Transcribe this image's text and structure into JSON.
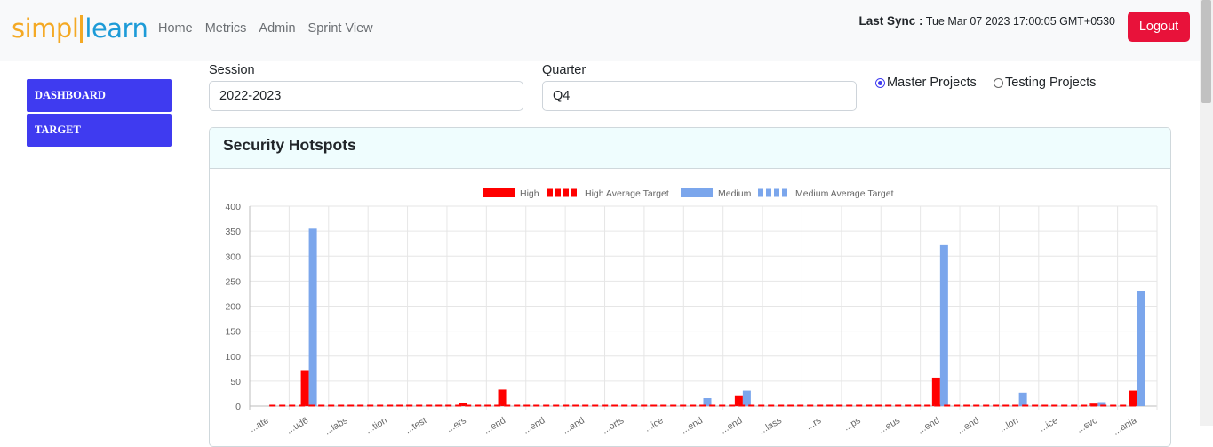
{
  "navbar": {
    "logo": {
      "part1": "simpl",
      "part2": "learn"
    },
    "links": [
      "Home",
      "Metrics",
      "Admin",
      "Sprint View"
    ],
    "last_sync_label": "Last Sync :",
    "last_sync_value": "Tue Mar 07 2023 17:00:05 GMT+0530",
    "logout_label": "Logout"
  },
  "sidebar": {
    "items": [
      "DASHBOARD",
      "TARGET"
    ]
  },
  "filters": {
    "session_label": "Session",
    "session_value": "2022-2023",
    "quarter_label": "Quarter",
    "quarter_value": "Q4",
    "radio_master": "Master Projects",
    "radio_testing": "Testing Projects",
    "selected": "master"
  },
  "card": {
    "title": "Security Hotspots"
  },
  "colors": {
    "high": "#ff0000",
    "medium": "#7ba6ec",
    "accent": "#3f3bf0",
    "logout": "#e8123a"
  },
  "chart_data": {
    "type": "bar",
    "ylim": [
      0,
      400
    ],
    "yticks": [
      0,
      50,
      100,
      150,
      200,
      250,
      300,
      350,
      400
    ],
    "grid": true,
    "legend_position": "top",
    "legend": [
      "High",
      "High Average Target",
      "Medium",
      "Medium Average Target"
    ],
    "categories": [
      "...ate",
      "...ud6",
      "...labs",
      "...tion",
      "...test",
      "...ers",
      "...end",
      "...end",
      "...and",
      "...orts",
      "...ice",
      "...end",
      "...end",
      "...lass",
      "...rs",
      "...ps",
      "...eus",
      "...end",
      "...end",
      "...lon",
      "...ice",
      "...svc",
      "...ania"
    ],
    "series": [
      {
        "name": "High",
        "values": [
          0,
          72,
          0,
          0,
          0,
          6,
          33,
          0,
          0,
          0,
          0,
          0,
          20,
          0,
          0,
          0,
          0,
          57,
          0,
          0,
          0,
          5,
          31
        ]
      },
      {
        "name": "Medium",
        "values": [
          0,
          355,
          0,
          0,
          0,
          0,
          0,
          0,
          0,
          0,
          0,
          16,
          31,
          0,
          0,
          0,
          0,
          322,
          0,
          27,
          0,
          8,
          230
        ]
      },
      {
        "name": "High Average Target",
        "values": [
          1,
          1,
          1,
          1,
          1,
          1,
          1,
          1,
          1,
          1,
          1,
          1,
          1,
          1,
          1,
          1,
          1,
          1,
          1,
          1,
          1,
          1,
          1
        ]
      },
      {
        "name": "Medium Average Target",
        "values": [
          1,
          1,
          1,
          1,
          1,
          1,
          1,
          1,
          1,
          1,
          1,
          1,
          1,
          1,
          1,
          1,
          1,
          1,
          1,
          1,
          1,
          1,
          1
        ]
      }
    ]
  }
}
